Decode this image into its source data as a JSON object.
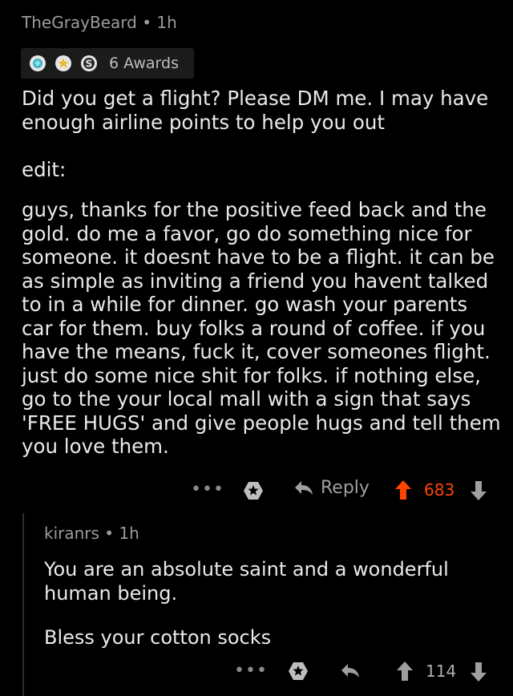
{
  "comment": {
    "username": "TheGrayBeard",
    "separator": "•",
    "time": "1h",
    "awards_label": "6 Awards",
    "paragraphs": [
      "Did you get a flight? Please DM me.  I may have enough airline points to help you out",
      "edit:",
      "guys, thanks for the positive feed back and the gold.  do me a favor, go do something nice for someone.  it doesnt have to be a flight.  it can be as simple as inviting a friend you havent talked to in a while for dinner.  go wash your parents car for them.  buy folks a round of coffee.  if you have the means, fuck it, cover someones flight.  just do some nice shit for folks.  if nothing else, go to the your local mall with a sign that says 'FREE HUGS' and give people hugs and tell them you love them."
    ],
    "actions": {
      "more": "•••",
      "reply_label": "Reply",
      "score": "683"
    }
  },
  "reply": {
    "username": "kiranrs",
    "separator": "•",
    "time": "1h",
    "paragraphs": [
      "You are an absolute saint and a wonderful human being.",
      "Bless your cotton socks"
    ],
    "actions": {
      "more": "•••",
      "score": "114"
    }
  },
  "colors": {
    "background": "#000000",
    "upvoted": "#ff4500",
    "muted": "#9b9b9b"
  },
  "icons": [
    "gold-award-icon",
    "star-award-icon",
    "silver-award-icon",
    "more-icon",
    "award-icon",
    "reply-icon",
    "upvote-icon",
    "downvote-icon"
  ]
}
